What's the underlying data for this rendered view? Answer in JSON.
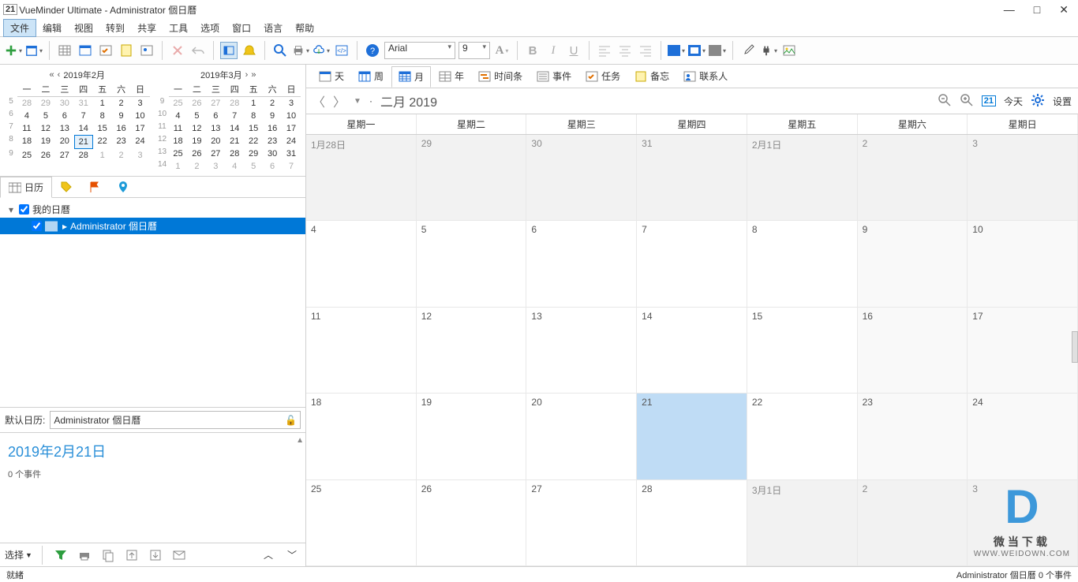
{
  "title": "VueMinder Ultimate - Administrator 個日曆",
  "title_icon": "21",
  "menu": [
    "文件",
    "编辑",
    "视图",
    "转到",
    "共享",
    "工具",
    "选项",
    "窗口",
    "语言",
    "帮助"
  ],
  "menu_active": 0,
  "font_name": "Arial",
  "font_size": "9",
  "minical1": {
    "title": "2019年2月",
    "dow": [
      "一",
      "二",
      "三",
      "四",
      "五",
      "六",
      "日"
    ],
    "weeks": [
      5,
      6,
      7,
      8,
      9
    ],
    "rows": [
      [
        28,
        29,
        30,
        31,
        1,
        2,
        3
      ],
      [
        4,
        5,
        6,
        7,
        8,
        9,
        10
      ],
      [
        11,
        12,
        13,
        14,
        15,
        16,
        17
      ],
      [
        18,
        19,
        20,
        21,
        22,
        23,
        24
      ],
      [
        25,
        26,
        27,
        28,
        1,
        2,
        3
      ]
    ],
    "today": [
      3,
      3
    ],
    "other_before": 4,
    "other_after": 3
  },
  "minical2": {
    "title": "2019年3月",
    "dow": [
      "一",
      "二",
      "三",
      "四",
      "五",
      "六",
      "日"
    ],
    "weeks": [
      9,
      10,
      11,
      12,
      13,
      14
    ],
    "rows": [
      [
        25,
        26,
        27,
        28,
        1,
        2,
        3
      ],
      [
        4,
        5,
        6,
        7,
        8,
        9,
        10
      ],
      [
        11,
        12,
        13,
        14,
        15,
        16,
        17
      ],
      [
        18,
        19,
        20,
        21,
        22,
        23,
        24
      ],
      [
        25,
        26,
        27,
        28,
        29,
        30,
        31
      ],
      [
        1,
        2,
        3,
        4,
        5,
        6,
        7
      ]
    ],
    "other_before": 4,
    "other_after": 7
  },
  "left_tabs": {
    "cal": "日历"
  },
  "tree": {
    "root": "我的日曆",
    "child": "Administrator 個日曆"
  },
  "default_cal_label": "默认日历:",
  "default_cal_value": "Administrator 個日曆",
  "detail_date": "2019年2月21日",
  "detail_events": "0 个事件",
  "select_label": "选择",
  "viewtabs": {
    "day": "天",
    "week": "周",
    "month": "月",
    "year": "年",
    "timeline": "时间条",
    "event": "事件",
    "task": "任务",
    "note": "备忘",
    "contact": "联系人"
  },
  "month_title": "二月 2019",
  "today_label": "今天",
  "today_box": "21",
  "settings_label": "设置",
  "dow_full": [
    "星期一",
    "星期二",
    "星期三",
    "星期四",
    "星期五",
    "星期六",
    "星期日"
  ],
  "grid": [
    [
      "1月28日",
      "29",
      "30",
      "31",
      "2月1日",
      "2",
      "3"
    ],
    [
      "4",
      "5",
      "6",
      "7",
      "8",
      "9",
      "10"
    ],
    [
      "11",
      "12",
      "13",
      "14",
      "15",
      "16",
      "17"
    ],
    [
      "18",
      "19",
      "20",
      "21",
      "22",
      "23",
      "24"
    ],
    [
      "25",
      "26",
      "27",
      "28",
      "3月1日",
      "2",
      "3"
    ]
  ],
  "grid_other_rows": [
    0
  ],
  "grid_other_cells": [
    [
      4,
      4
    ],
    [
      4,
      5
    ],
    [
      4,
      6
    ]
  ],
  "grid_today": [
    3,
    3
  ],
  "grid_weekend_cols": [
    5,
    6
  ],
  "status_left": "就緒",
  "status_right": "Administrator 個日曆   0 个事件",
  "watermark": {
    "brand": "微当下载",
    "url": "WWW.WEIDOWN.COM"
  },
  "colors": {
    "fill": "#1e6fd8",
    "border": "#1e6fd8",
    "gray": "#888"
  }
}
